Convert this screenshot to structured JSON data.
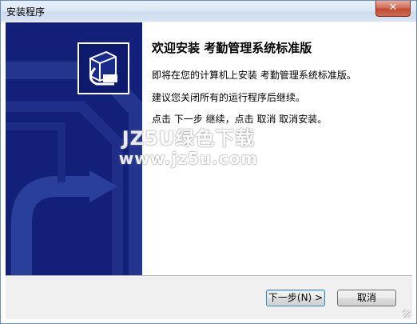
{
  "window": {
    "title": "安装程序",
    "close_label": "✕"
  },
  "sidebar": {
    "logo_icon": "installer-box-icon"
  },
  "content": {
    "heading": "欢迎安装 考勤管理系统标准版",
    "lines": [
      "即将在您的计算机上安装 考勤管理系统标准版。",
      "建议您关闭所有的运行程序后继续。",
      "点击 下一步 继续，点击 取消 取消安装。"
    ]
  },
  "watermark": {
    "line1": "JZ5U绿色下载",
    "line2": "www.jz5u.com"
  },
  "footer": {
    "next_label": "下一步(N) >",
    "cancel_label": "取消"
  }
}
